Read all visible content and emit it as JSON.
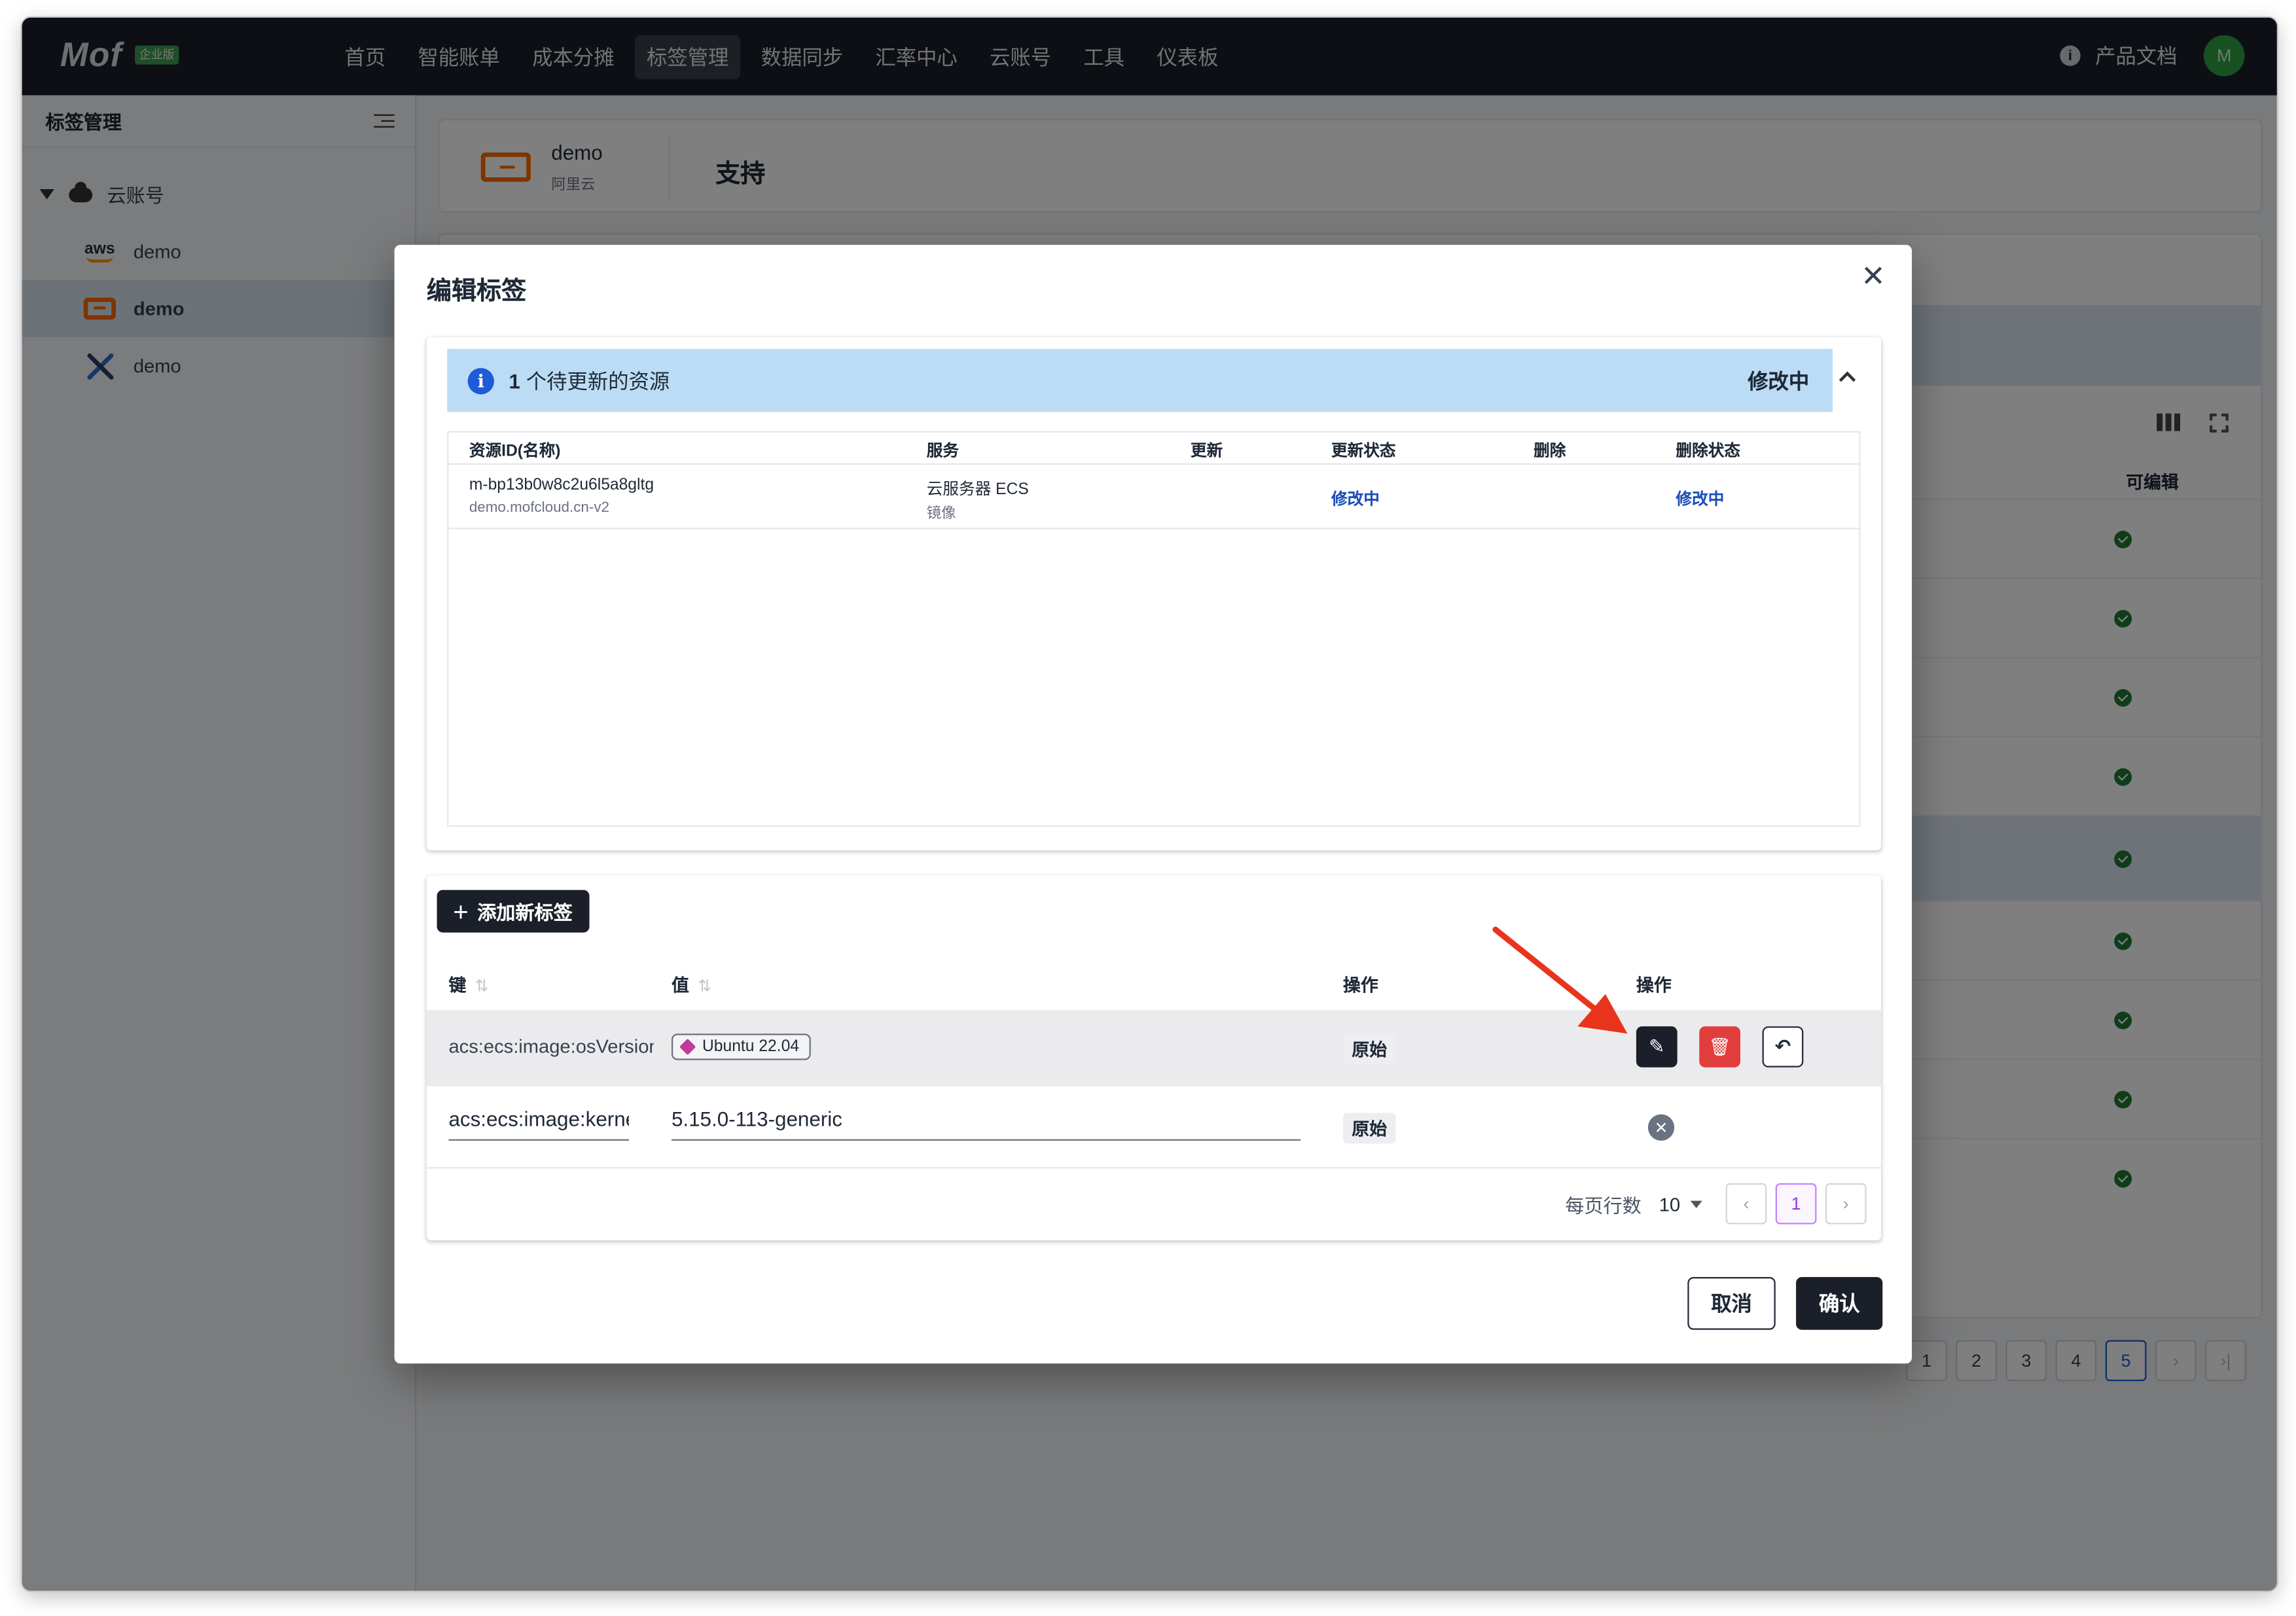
{
  "app": {
    "logo": "Mof",
    "edition": "企业版"
  },
  "nav": {
    "items": [
      "首页",
      "智能账单",
      "成本分摊",
      "标签管理",
      "数据同步",
      "汇率中心",
      "云账号",
      "工具",
      "仪表板"
    ],
    "active": "标签管理",
    "info_icon": "info-icon",
    "docs": "产品文档",
    "avatar": "M"
  },
  "sidebar": {
    "title": "标签管理",
    "root": "云账号",
    "accounts": [
      {
        "icon": "aws-logo",
        "name": "demo"
      },
      {
        "icon": "aliyun-logo",
        "name": "demo",
        "selected": true
      },
      {
        "icon": "tools-logo",
        "name": "demo"
      }
    ]
  },
  "account_header": {
    "name": "demo",
    "provider": "阿里云",
    "support": "支持"
  },
  "background_table": {
    "column": "可编辑",
    "pager": {
      "pages": [
        "1",
        "2",
        "3",
        "4",
        "5"
      ],
      "current": "5",
      "next": "›",
      "last": "›|"
    }
  },
  "modal": {
    "title": "编辑标签",
    "pending": {
      "count": "1",
      "text": "个待更新的资源",
      "status": "修改中",
      "columns": [
        "资源ID(名称)",
        "服务",
        "更新",
        "更新状态",
        "删除",
        "删除状态"
      ],
      "rows": [
        {
          "resource_id": "m-bp13b0w8c2u6l5a8gltg",
          "resource_name": "demo.mofcloud.cn-v2",
          "service": "云服务器 ECS",
          "service_sub": "镜像",
          "update": "",
          "update_status": "修改中",
          "delete": "",
          "delete_status": "修改中"
        }
      ]
    },
    "tags": {
      "add_button": "添加新标签",
      "columns": {
        "key": "键",
        "value": "值",
        "op1": "操作",
        "op2": "操作"
      },
      "rows": [
        {
          "key": "acs:ecs:image:osVersion",
          "value": "Ubuntu 22.04",
          "state": "原始",
          "mode": "view"
        },
        {
          "key": "acs:ecs:image:kernel",
          "value": "5.15.0-113-generic",
          "state": "原始",
          "mode": "edit"
        }
      ],
      "pagination": {
        "rows_per_page_label": "每页行数",
        "rows_per_page": "10",
        "current_page": "1"
      }
    },
    "cancel": "取消",
    "confirm": "确认"
  },
  "colors": {
    "nav_bg": "#1b1f2a",
    "accent": "#1d5bd8",
    "danger": "#e23d3d",
    "aliyun": "#ff6a00",
    "annotation_arrow": "#e8341c"
  }
}
